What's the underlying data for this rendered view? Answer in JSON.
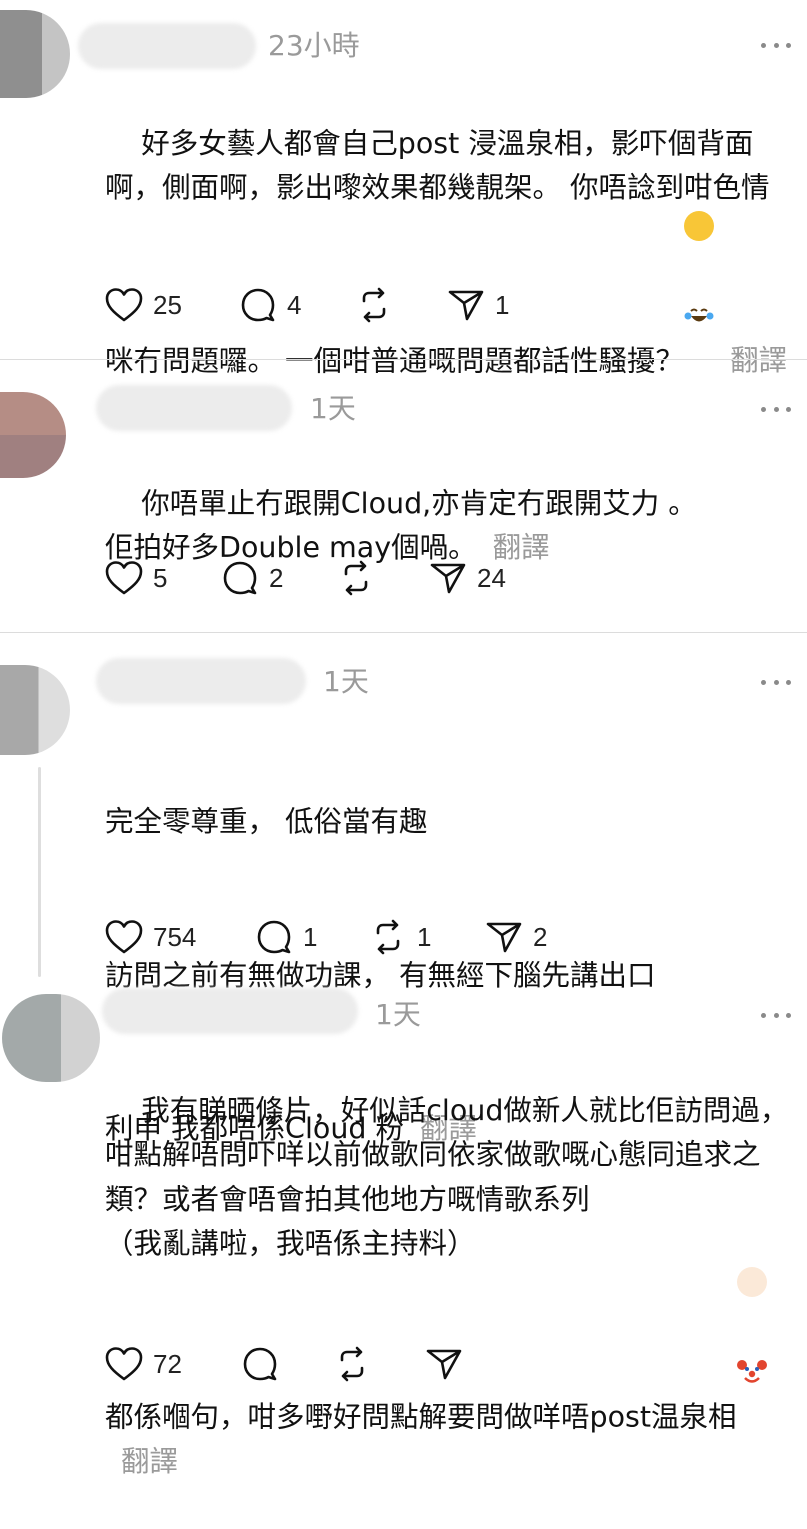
{
  "posts": [
    {
      "time": "23小時",
      "paragraphs": [
        "好多女藝人都會自己post 浸溫泉相，影吓個背面啊，側面啊，影出嚟效果都幾靚架。 你唔諗到咁色情咪冇問題囉。 一個咁普通嘅問題都話性騷擾？"
      ],
      "emoji_name": "tears-of-joy-emoji",
      "translate": "翻譯",
      "likes": "25",
      "replies": "4",
      "reposts": "",
      "shares": "1"
    },
    {
      "time": "1天",
      "paragraphs": [
        "你唔單止冇跟開Cloud,亦肯定冇跟開艾力 。\n佢拍好多Double may個喎。"
      ],
      "translate": "翻譯",
      "likes": "5",
      "replies": "2",
      "reposts": "",
      "shares": "24"
    },
    {
      "time": "1天",
      "paragraphs": [
        "完全零尊重， 低俗當有趣",
        "訪問之前有無做功課， 有無經下腦先講出口",
        "利申 我都唔係Cloud 粉"
      ],
      "translate": "翻譯",
      "likes": "754",
      "replies": "1",
      "reposts": "1",
      "shares": "2"
    },
    {
      "time": "1天",
      "paragraphs": [
        "我有睇晒條片，好似話cloud做新人就比佢訪問過，咁點解唔問吓咩以前做歌同依家做歌嘅心態同追求之類？或者會唔會拍其他地方嘅情歌系列\n（我亂講啦，我唔係主持料）\n都係嗰句，咁多嘢好問點解要問做咩唔post温泉相"
      ],
      "emoji_name": "clown-face-emoji",
      "translate": "翻譯",
      "likes": "72",
      "replies": "",
      "reposts": "",
      "shares": ""
    }
  ]
}
